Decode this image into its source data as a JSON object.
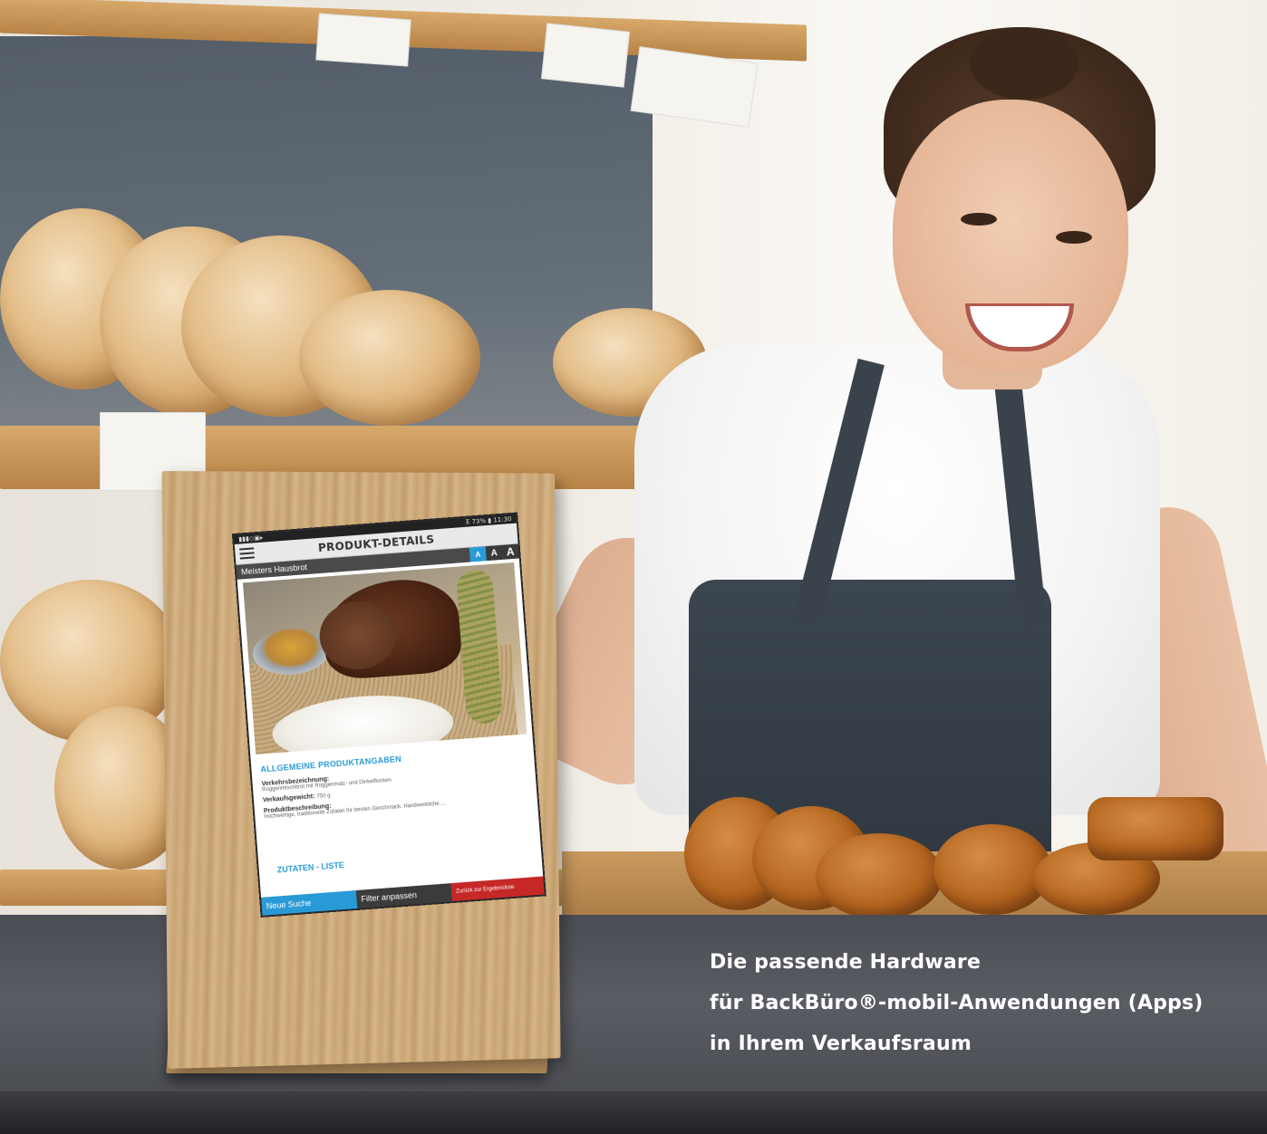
{
  "scene": {
    "description_icons": [
      "bread-shelf",
      "bakery-woman",
      "pastry-tray"
    ]
  },
  "tablet": {
    "statusbar": {
      "left_icons": "▮▮▮◇▣▸",
      "right": "⊼ 73% ▮ 11:30"
    },
    "app_title": "PRODUKT-DETAILS",
    "product_name": "Meisters Hausbrot",
    "font_size_buttons": [
      "A",
      "A",
      "A"
    ],
    "section_general": "ALLGEMEINE PRODUKTANGABEN",
    "fields": {
      "verkehrsbezeichnung_label": "Verkehrsbezeichnung:",
      "verkehrsbezeichnung_value": "Roggenmischbrot mit Roggenmalz- und Dinkelflocken",
      "verkaufsgewicht_label": "Verkaufsgewicht:",
      "verkaufsgewicht_value": "750 g",
      "produktbeschreibung_label": "Produktbeschreibung:",
      "produktbeschreibung_value": "Hochwertige, traditionelle Zutaten für besten Geschmack. Handwerkliche ..."
    },
    "section_ingredients": "ZUTATEN - LISTE",
    "bottom_buttons": {
      "new_search": "Neue Suche",
      "filter": "Filter anpassen",
      "back": "Zurück zur Ergebnisliste"
    }
  },
  "caption": {
    "line1": "Die passende Hardware",
    "line2": "für BackBüro®-mobil-Anwendungen (Apps)",
    "line3": "in Ihrem Verkaufsraum"
  },
  "colors": {
    "accent_blue": "#2a9ad6",
    "dark_bar": "#3b3b3b",
    "back_red": "#c62828"
  }
}
